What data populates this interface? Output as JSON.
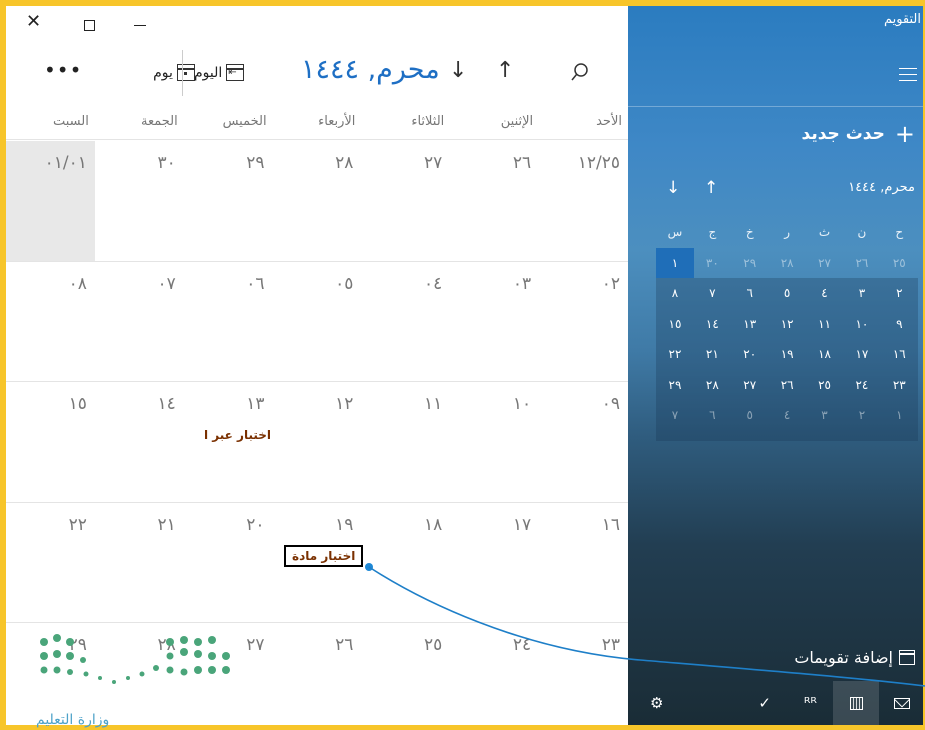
{
  "window": {
    "title": "التقويم"
  },
  "toolbar": {
    "more_label": "•••",
    "day_view_label": "يوم",
    "today_label": "اليوم",
    "month_title": "محرم, ١٤٤٤"
  },
  "weekdays": [
    "الأحد",
    "الإثنين",
    "الثلاثاء",
    "الأربعاء",
    "الخميس",
    "الجمعة",
    "السبت"
  ],
  "weeks": [
    [
      "١٢/٢٥",
      "٢٦",
      "٢٧",
      "٢٨",
      "٢٩",
      "٣٠",
      "٠١/٠١"
    ],
    [
      "٠٢",
      "٠٣",
      "٠٤",
      "٠٥",
      "٠٦",
      "٠٧",
      "٠٨"
    ],
    [
      "٠٩",
      "١٠",
      "١١",
      "١٢",
      "١٣",
      "١٤",
      "١٥"
    ],
    [
      "١٦",
      "١٧",
      "١٨",
      "١٩",
      "٢٠",
      "٢١",
      "٢٢"
    ],
    [
      "٢٣",
      "٢٤",
      "٢٥",
      "٢٦",
      "٢٧",
      "٢٨",
      "٢٩"
    ]
  ],
  "events": [
    {
      "title": "اختبار عبر ا",
      "day": "١٣"
    },
    {
      "title": "اختبار مادة",
      "day": "١٩"
    }
  ],
  "sidebar": {
    "new_event_label": "حدث جديد",
    "mini_month_title": "محرم, ١٤٤٤",
    "mini_weekdays": [
      "ح",
      "ن",
      "ث",
      "ر",
      "خ",
      "ج",
      "س"
    ],
    "mini_weeks": [
      [
        "٢٥",
        "٢٦",
        "٢٧",
        "٢٨",
        "٢٩",
        "٣٠",
        "١"
      ],
      [
        "٢",
        "٣",
        "٤",
        "٥",
        "٦",
        "٧",
        "٨"
      ],
      [
        "٩",
        "١٠",
        "١١",
        "١٢",
        "١٣",
        "١٤",
        "١٥"
      ],
      [
        "١٦",
        "١٧",
        "١٨",
        "١٩",
        "٢٠",
        "٢١",
        "٢٢"
      ],
      [
        "٢٣",
        "٢٤",
        "٢٥",
        "٢٦",
        "٢٧",
        "٢٨",
        "٢٩"
      ],
      [
        "١",
        "٢",
        "٣",
        "٤",
        "٥",
        "٦",
        "٧"
      ]
    ],
    "add_calendars_label": "إضافة تقويمات",
    "bottom_nav": [
      "mail-icon",
      "calendar-icon",
      "people-icon",
      "todo-icon",
      "settings-icon"
    ]
  },
  "colors": {
    "accent": "#1e6fc4",
    "event_text": "#7a3000",
    "frame": "#f7c52a"
  },
  "logo_text": "وزارة التعليم"
}
